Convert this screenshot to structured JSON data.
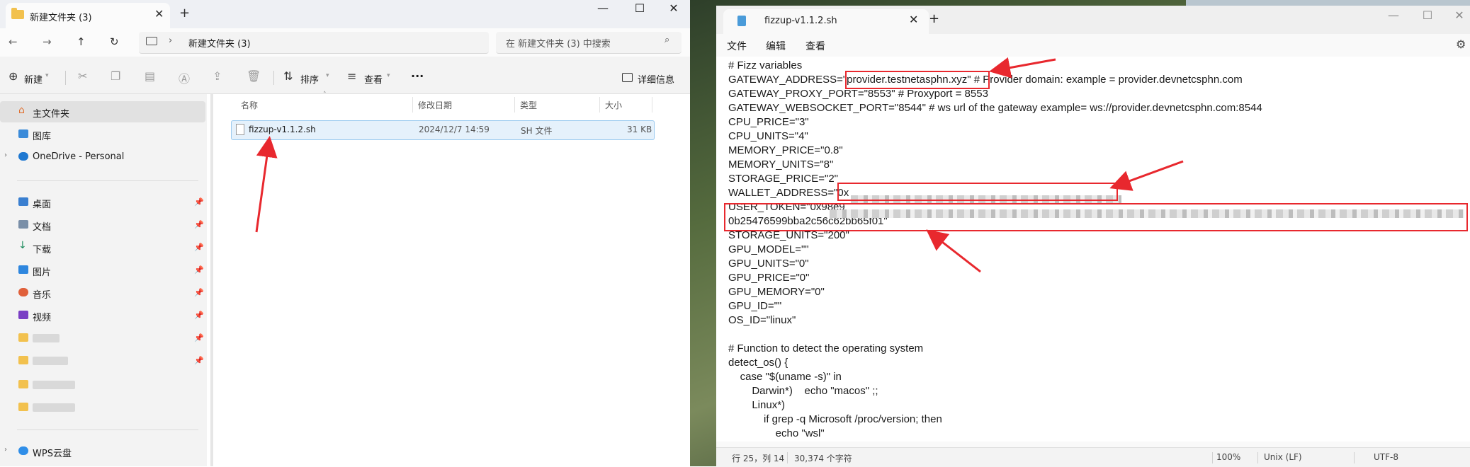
{
  "explorer": {
    "tab_title": "新建文件夹 (3)",
    "tab_close": "✕",
    "new_tab": "+",
    "window_controls": [
      "—",
      "☐",
      "✕"
    ],
    "nav": {
      "back": "←",
      "forward": "→",
      "up": "↑",
      "refresh": "↻"
    },
    "breadcrumb": "新建文件夹 (3)",
    "breadcrumb_sep": "›",
    "search_placeholder": "在 新建文件夹 (3) 中搜索",
    "toolbar": {
      "new_label": "新建",
      "sort_label": "排序",
      "view_label": "查看",
      "more": "···",
      "details_label": "详细信息"
    },
    "sidebar": {
      "home": "主文件夹",
      "gallery": "图库",
      "onedrive": "OneDrive - Personal",
      "quick": [
        {
          "label": "桌面",
          "icon": "desktop-icon"
        },
        {
          "label": "文档",
          "icon": "documents-icon"
        },
        {
          "label": "下载",
          "icon": "downloads-icon"
        },
        {
          "label": "图片",
          "icon": "pictures-icon"
        },
        {
          "label": "音乐",
          "icon": "music-icon"
        },
        {
          "label": "视频",
          "icon": "videos-icon"
        }
      ],
      "wps": "WPS云盘"
    },
    "columns": {
      "name": "名称",
      "date": "修改日期",
      "type": "类型",
      "size": "大小"
    },
    "file": {
      "name": "fizzup-v1.1.2.sh",
      "date": "2024/12/7 14:59",
      "type": "SH 文件",
      "size": "31 KB"
    }
  },
  "notepad": {
    "tab_title": "fizzup-v1.1.2.sh",
    "tab_close": "✕",
    "new_tab": "+",
    "window_controls": [
      "—",
      "☐",
      "✕"
    ],
    "menu": {
      "file": "文件",
      "edit": "编辑",
      "view": "查看"
    },
    "lines": [
      "# Fizz variables",
      "GATEWAY_ADDRESS=\"provider.testnetasphn.xyz\" # Provider domain: example = provider.devnetcsphn.com",
      "GATEWAY_PROXY_PORT=\"8553\" # Proxyport = 8553",
      "GATEWAY_WEBSOCKET_PORT=\"8544\" # ws url of the gateway example= ws://provider.devnetcsphn.com:8544",
      "CPU_PRICE=\"3\"",
      "CPU_UNITS=\"4\"",
      "MEMORY_PRICE=\"0.8\"",
      "MEMORY_UNITS=\"8\"",
      "STORAGE_PRICE=\"2\"",
      "WALLET_ADDRESS=\"0x",
      "USER_TOKEN=\"0x98e9",
      "0b25476599bba2c56c62bb65f01\"",
      "STORAGE_UNITS=\"200\"",
      "GPU_MODEL=\"\"",
      "GPU_UNITS=\"0\"",
      "GPU_PRICE=\"0\"",
      "GPU_MEMORY=\"0\"",
      "GPU_ID=\"\"",
      "OS_ID=\"linux\"",
      "",
      "# Function to detect the operating system",
      "detect_os() {",
      "    case \"$(uname -s)\" in",
      "        Darwin*)    echo \"macos\" ;;",
      "        Linux*)",
      "            if grep -q Microsoft /proc/version; then",
      "                echo \"wsl\""
    ],
    "status": {
      "position": "行 25，列 14",
      "chars": "30,374 个字符",
      "zoom": "100%",
      "eol": "Unix (LF)",
      "encoding": "UTF-8"
    }
  },
  "colors": {
    "annotation_red": "#e8282e",
    "selection_blue": "#e5f1fb",
    "folder_yellow": "#f2c14e"
  }
}
